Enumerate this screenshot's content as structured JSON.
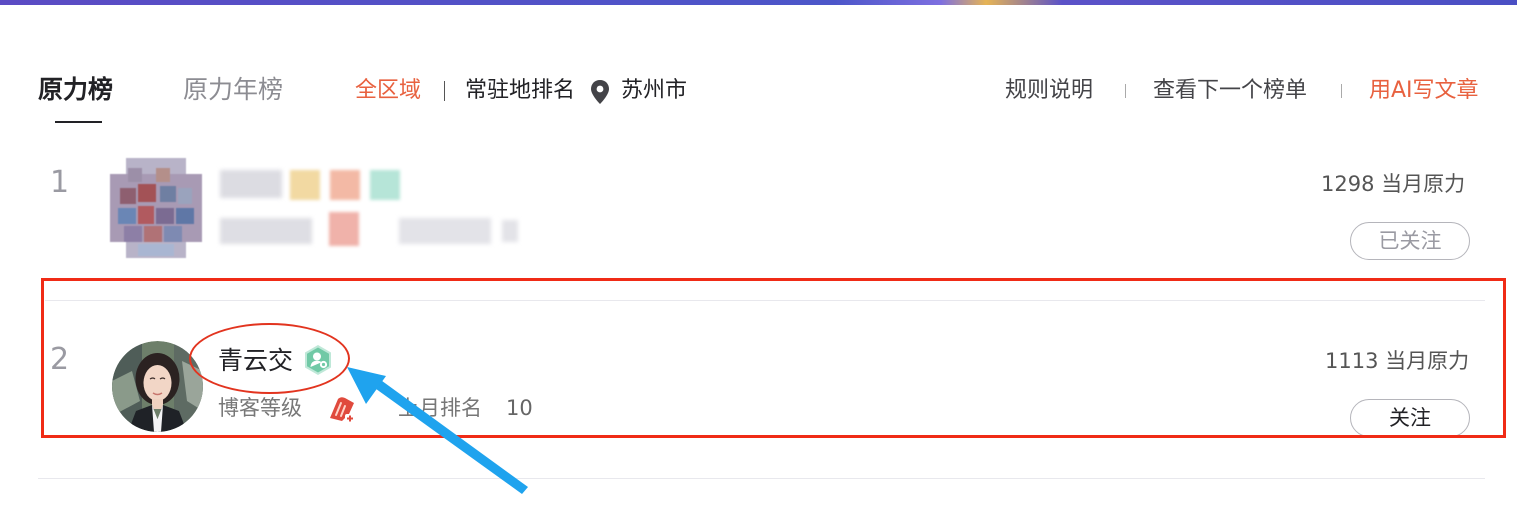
{
  "tabs": {
    "active_label": "原力榜",
    "year_label": "原力年榜"
  },
  "filters": {
    "region_label": "全区域",
    "resident_label": "常驻地排名",
    "location_icon": "location-pin-icon",
    "city": "苏州市"
  },
  "links": {
    "rules": "规则说明",
    "next_board": "查看下一个榜单",
    "ai_write": "用AI写文章"
  },
  "rows": [
    {
      "rank": "1",
      "score": "1298 当月原力",
      "follow_label": "已关注"
    },
    {
      "rank": "2",
      "name": "青云交",
      "verified_icon": "verified-user-icon",
      "blog_level_label": "博客等级",
      "level_icon": "blog-level-badge-icon",
      "last_month_rank_label": "上月排名",
      "last_month_rank_value": "10",
      "score": "1113 当月原力",
      "follow_label": "关注"
    }
  ],
  "colors": {
    "accent": "#e8613f",
    "annotation_red": "#f02b16",
    "annotation_arrow": "#1fa3ee"
  }
}
